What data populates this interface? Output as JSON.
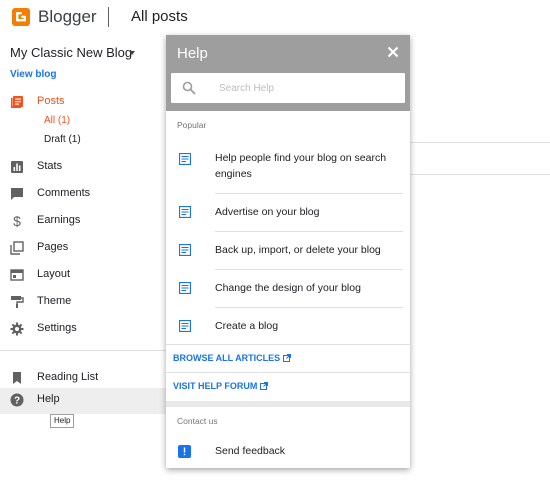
{
  "header": {
    "brand": "Blogger",
    "page_title": "All posts"
  },
  "sidebar": {
    "blog_name": "My Classic New Blog",
    "view_blog": "View blog",
    "items": [
      {
        "label": "Posts",
        "icon": "posts-icon"
      },
      {
        "label": "Stats",
        "icon": "stats-icon"
      },
      {
        "label": "Comments",
        "icon": "comments-icon"
      },
      {
        "label": "Earnings",
        "icon": "dollar-icon"
      },
      {
        "label": "Pages",
        "icon": "pages-icon"
      },
      {
        "label": "Layout",
        "icon": "layout-icon"
      },
      {
        "label": "Theme",
        "icon": "paint-roller-icon"
      },
      {
        "label": "Settings",
        "icon": "gear-icon"
      },
      {
        "label": "Reading List",
        "icon": "bookmark-icon"
      },
      {
        "label": "Help",
        "icon": "help-circle-icon"
      }
    ],
    "posts_sub": {
      "all": "All (1)",
      "draft": "Draft (1)"
    },
    "tooltip": "Help"
  },
  "help_panel": {
    "title": "Help",
    "search_placeholder": "Search Help",
    "popular_label": "Popular",
    "articles": [
      "Help people find your blog on search engines",
      "Advertise on your blog",
      "Back up, import, or delete your blog",
      "Change the design of your blog",
      "Create a blog"
    ],
    "browse_all": "BROWSE ALL ARTICLES",
    "visit_forum": "VISIT HELP FORUM",
    "contact_label": "Contact us",
    "send_feedback": "Send feedback"
  },
  "colors": {
    "brand_orange": "#f57d00",
    "active_orange": "#f4511e",
    "link_blue": "#1a73e8",
    "panel_header": "#9e9e9e"
  }
}
